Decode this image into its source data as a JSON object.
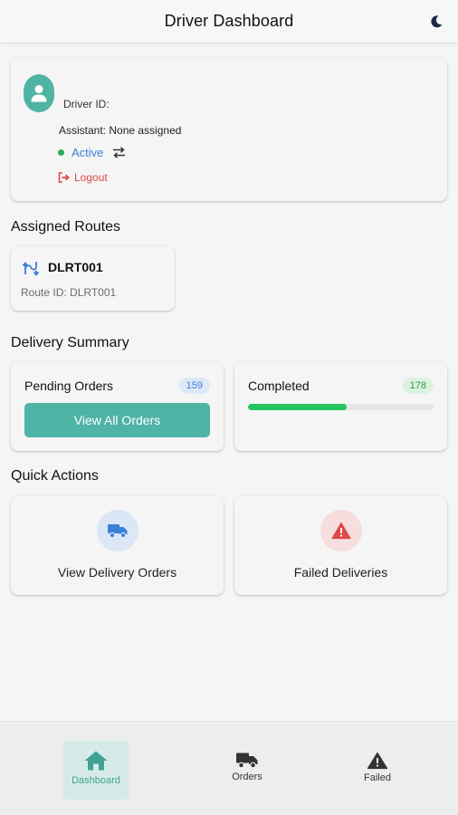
{
  "header": {
    "title": "Driver Dashboard",
    "theme_icon": "moon-icon"
  },
  "driver": {
    "driver_id_label": "Driver ID:",
    "assistant_label": "Assistant: None assigned",
    "status": "Active",
    "status_color": "#27ae60",
    "logout_label": "Logout"
  },
  "routes": {
    "section_title": "Assigned Routes",
    "items": [
      {
        "name": "DLRT001",
        "route_id": "Route ID: DLRT001"
      }
    ]
  },
  "summary": {
    "section_title": "Delivery Summary",
    "pending": {
      "title": "Pending Orders",
      "count": "159",
      "button_label": "View All Orders"
    },
    "completed": {
      "title": "Completed",
      "count": "178",
      "progress_fraction": 0.53
    }
  },
  "quick_actions": {
    "section_title": "Quick Actions",
    "items": [
      {
        "label": "View Delivery Orders",
        "icon": "truck-icon",
        "color": "#3b7fd6"
      },
      {
        "label": "Failed Deliveries",
        "icon": "warning-icon",
        "color": "#e04848"
      }
    ]
  },
  "bottom_nav": {
    "items": [
      {
        "label": "Dashboard",
        "icon": "home-icon",
        "active": true
      },
      {
        "label": "Orders",
        "icon": "truck-icon",
        "active": false
      },
      {
        "label": "Failed",
        "icon": "warning-icon",
        "active": false
      }
    ]
  },
  "colors": {
    "accent": "#4fb3a5",
    "progress": "#22c55e",
    "danger": "#e04848",
    "link": "#3b7fd6"
  }
}
